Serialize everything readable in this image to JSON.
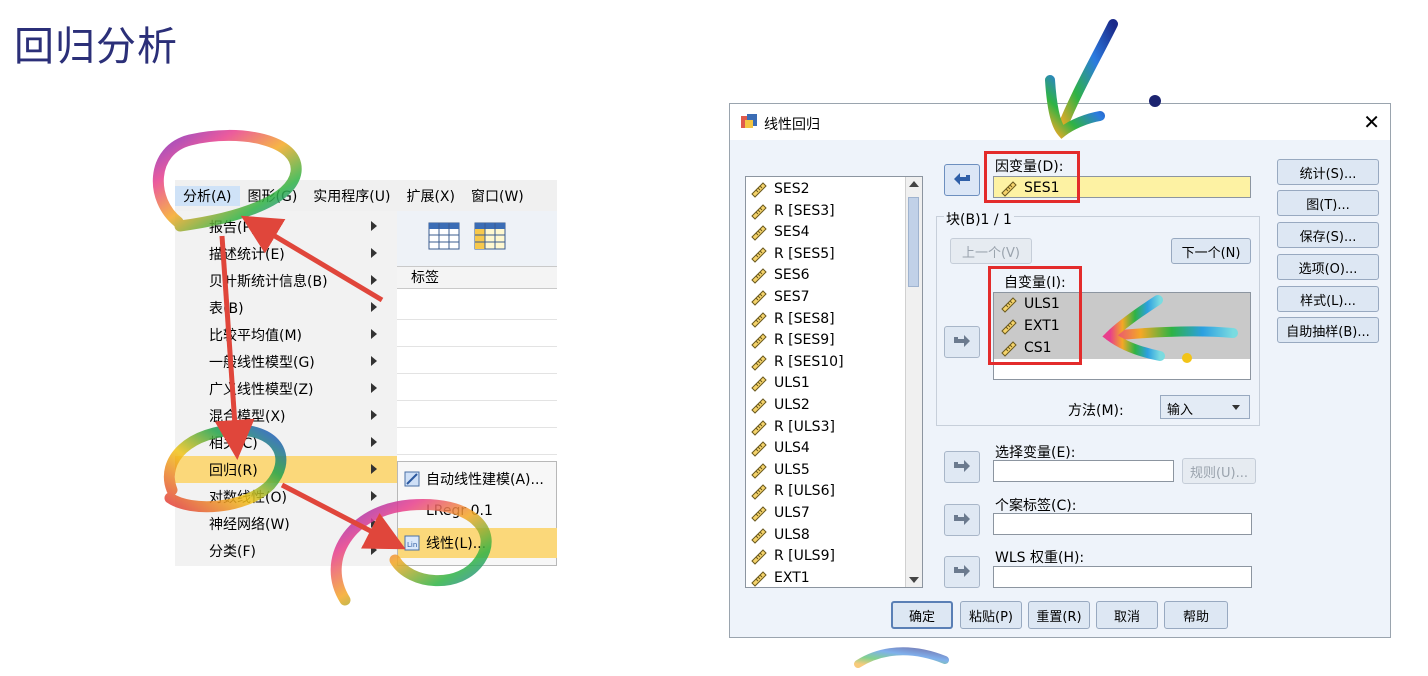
{
  "slide": {
    "title": "回归分析"
  },
  "spss_menu": {
    "menubar": [
      "分析(A)",
      "图形(G)",
      "实用程序(U)",
      "扩展(X)",
      "窗口(W)"
    ],
    "items": [
      {
        "label": "报告(P)",
        "submenu": true
      },
      {
        "label": "描述统计(E)",
        "submenu": true
      },
      {
        "label": "贝叶斯统计信息(B)",
        "submenu": true
      },
      {
        "label": "表(B)",
        "submenu": true
      },
      {
        "label": "比较平均值(M)",
        "submenu": true
      },
      {
        "label": "一般线性模型(G)",
        "submenu": true
      },
      {
        "label": "广义线性模型(Z)",
        "submenu": true
      },
      {
        "label": "混合模型(X)",
        "submenu": true
      },
      {
        "label": "相关(C)",
        "submenu": true
      },
      {
        "label": "回归(R)",
        "submenu": true,
        "highlighted": true
      },
      {
        "label": "对数线性(O)",
        "submenu": true
      },
      {
        "label": "神经网络(W)",
        "submenu": true
      },
      {
        "label": "分类(F)",
        "submenu": true
      }
    ],
    "column_header": "标签",
    "submenu_items": [
      {
        "label": "自动线性建模(A)...",
        "icon": "auto-linear-icon"
      },
      {
        "label": "LRegr 0.1",
        "icon": "lregr-icon"
      },
      {
        "label": "线性(L)...",
        "icon": "linear-icon",
        "highlighted": true
      }
    ]
  },
  "dialog": {
    "title": "线性回归",
    "close": "✕",
    "variables": [
      "SES2",
      "R [SES3]",
      "SES4",
      "R [SES5]",
      "SES6",
      "SES7",
      "R [SES8]",
      "R [SES9]",
      "R [SES10]",
      "ULS1",
      "ULS2",
      "R [ULS3]",
      "ULS4",
      "ULS5",
      "R [ULS6]",
      "ULS7",
      "ULS8",
      "R [ULS9]",
      "EXT1"
    ],
    "dependent_label": "因变量(D):",
    "dependent_value": "SES1",
    "block_label": "块(B)1 / 1",
    "prev_button": "上一个(V)",
    "next_button": "下一个(N)",
    "independent_label": "自变量(I):",
    "independents": [
      "ULS1",
      "EXT1",
      "CS1"
    ],
    "method_label": "方法(M):",
    "method_value": "输入",
    "selection_label": "选择变量(E):",
    "rule_button": "规则(U)...",
    "case_label": "个案标签(C):",
    "wls_label": "WLS 权重(H):",
    "side_buttons": [
      "统计(S)...",
      "图(T)...",
      "保存(S)...",
      "选项(O)...",
      "样式(L)...",
      "自助抽样(B)..."
    ],
    "bottom_buttons": [
      "确定",
      "粘贴(P)",
      "重置(R)",
      "取消",
      "帮助"
    ]
  },
  "colors": {
    "title": "#2b2f78",
    "highlight": "#fbd87a",
    "red_box": "#e32b2b",
    "dependent_field": "#fdf2a3"
  }
}
